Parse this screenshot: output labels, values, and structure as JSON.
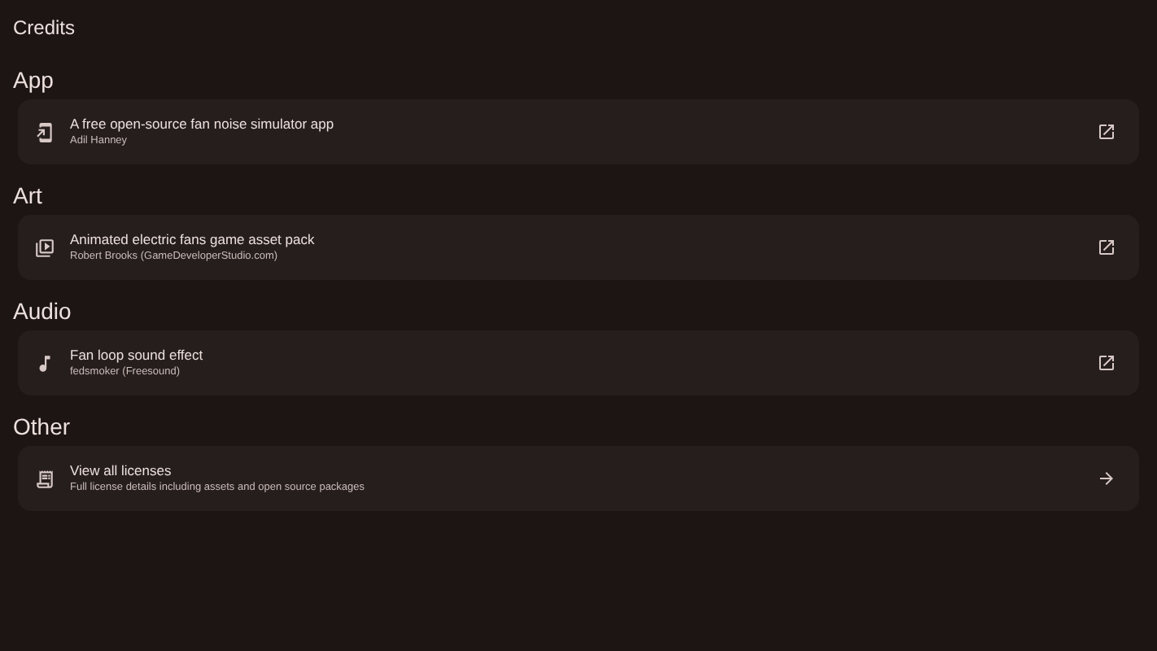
{
  "title": "Credits",
  "sections": [
    {
      "heading": "App",
      "items": [
        {
          "kind": "link",
          "title": "A free open-source fan noise simulator app",
          "subtitle": "Adil Hanney"
        }
      ]
    },
    {
      "heading": "Art",
      "items": [
        {
          "kind": "link",
          "title": "Animated electric fans game asset pack",
          "subtitle": "Robert Brooks (GameDeveloperStudio.com)"
        }
      ]
    },
    {
      "heading": "Audio",
      "items": [
        {
          "kind": "link",
          "title": "Fan loop sound effect",
          "subtitle": "fedsmoker (Freesound)"
        }
      ]
    },
    {
      "heading": "Other",
      "items": [
        {
          "kind": "page",
          "title": "View all licenses",
          "subtitle": "Full license details including assets and open source packages"
        }
      ]
    }
  ]
}
